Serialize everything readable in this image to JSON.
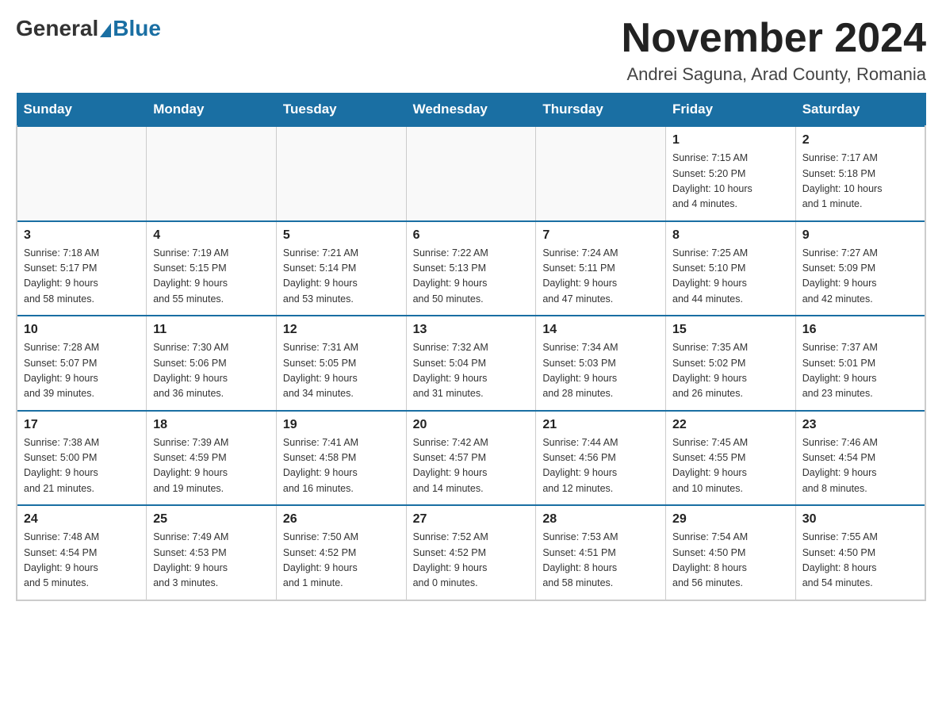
{
  "logo": {
    "general": "General",
    "blue": "Blue"
  },
  "title": "November 2024",
  "location": "Andrei Saguna, Arad County, Romania",
  "days_of_week": [
    "Sunday",
    "Monday",
    "Tuesday",
    "Wednesday",
    "Thursday",
    "Friday",
    "Saturday"
  ],
  "weeks": [
    [
      {
        "day": "",
        "info": ""
      },
      {
        "day": "",
        "info": ""
      },
      {
        "day": "",
        "info": ""
      },
      {
        "day": "",
        "info": ""
      },
      {
        "day": "",
        "info": ""
      },
      {
        "day": "1",
        "info": "Sunrise: 7:15 AM\nSunset: 5:20 PM\nDaylight: 10 hours\nand 4 minutes."
      },
      {
        "day": "2",
        "info": "Sunrise: 7:17 AM\nSunset: 5:18 PM\nDaylight: 10 hours\nand 1 minute."
      }
    ],
    [
      {
        "day": "3",
        "info": "Sunrise: 7:18 AM\nSunset: 5:17 PM\nDaylight: 9 hours\nand 58 minutes."
      },
      {
        "day": "4",
        "info": "Sunrise: 7:19 AM\nSunset: 5:15 PM\nDaylight: 9 hours\nand 55 minutes."
      },
      {
        "day": "5",
        "info": "Sunrise: 7:21 AM\nSunset: 5:14 PM\nDaylight: 9 hours\nand 53 minutes."
      },
      {
        "day": "6",
        "info": "Sunrise: 7:22 AM\nSunset: 5:13 PM\nDaylight: 9 hours\nand 50 minutes."
      },
      {
        "day": "7",
        "info": "Sunrise: 7:24 AM\nSunset: 5:11 PM\nDaylight: 9 hours\nand 47 minutes."
      },
      {
        "day": "8",
        "info": "Sunrise: 7:25 AM\nSunset: 5:10 PM\nDaylight: 9 hours\nand 44 minutes."
      },
      {
        "day": "9",
        "info": "Sunrise: 7:27 AM\nSunset: 5:09 PM\nDaylight: 9 hours\nand 42 minutes."
      }
    ],
    [
      {
        "day": "10",
        "info": "Sunrise: 7:28 AM\nSunset: 5:07 PM\nDaylight: 9 hours\nand 39 minutes."
      },
      {
        "day": "11",
        "info": "Sunrise: 7:30 AM\nSunset: 5:06 PM\nDaylight: 9 hours\nand 36 minutes."
      },
      {
        "day": "12",
        "info": "Sunrise: 7:31 AM\nSunset: 5:05 PM\nDaylight: 9 hours\nand 34 minutes."
      },
      {
        "day": "13",
        "info": "Sunrise: 7:32 AM\nSunset: 5:04 PM\nDaylight: 9 hours\nand 31 minutes."
      },
      {
        "day": "14",
        "info": "Sunrise: 7:34 AM\nSunset: 5:03 PM\nDaylight: 9 hours\nand 28 minutes."
      },
      {
        "day": "15",
        "info": "Sunrise: 7:35 AM\nSunset: 5:02 PM\nDaylight: 9 hours\nand 26 minutes."
      },
      {
        "day": "16",
        "info": "Sunrise: 7:37 AM\nSunset: 5:01 PM\nDaylight: 9 hours\nand 23 minutes."
      }
    ],
    [
      {
        "day": "17",
        "info": "Sunrise: 7:38 AM\nSunset: 5:00 PM\nDaylight: 9 hours\nand 21 minutes."
      },
      {
        "day": "18",
        "info": "Sunrise: 7:39 AM\nSunset: 4:59 PM\nDaylight: 9 hours\nand 19 minutes."
      },
      {
        "day": "19",
        "info": "Sunrise: 7:41 AM\nSunset: 4:58 PM\nDaylight: 9 hours\nand 16 minutes."
      },
      {
        "day": "20",
        "info": "Sunrise: 7:42 AM\nSunset: 4:57 PM\nDaylight: 9 hours\nand 14 minutes."
      },
      {
        "day": "21",
        "info": "Sunrise: 7:44 AM\nSunset: 4:56 PM\nDaylight: 9 hours\nand 12 minutes."
      },
      {
        "day": "22",
        "info": "Sunrise: 7:45 AM\nSunset: 4:55 PM\nDaylight: 9 hours\nand 10 minutes."
      },
      {
        "day": "23",
        "info": "Sunrise: 7:46 AM\nSunset: 4:54 PM\nDaylight: 9 hours\nand 8 minutes."
      }
    ],
    [
      {
        "day": "24",
        "info": "Sunrise: 7:48 AM\nSunset: 4:54 PM\nDaylight: 9 hours\nand 5 minutes."
      },
      {
        "day": "25",
        "info": "Sunrise: 7:49 AM\nSunset: 4:53 PM\nDaylight: 9 hours\nand 3 minutes."
      },
      {
        "day": "26",
        "info": "Sunrise: 7:50 AM\nSunset: 4:52 PM\nDaylight: 9 hours\nand 1 minute."
      },
      {
        "day": "27",
        "info": "Sunrise: 7:52 AM\nSunset: 4:52 PM\nDaylight: 9 hours\nand 0 minutes."
      },
      {
        "day": "28",
        "info": "Sunrise: 7:53 AM\nSunset: 4:51 PM\nDaylight: 8 hours\nand 58 minutes."
      },
      {
        "day": "29",
        "info": "Sunrise: 7:54 AM\nSunset: 4:50 PM\nDaylight: 8 hours\nand 56 minutes."
      },
      {
        "day": "30",
        "info": "Sunrise: 7:55 AM\nSunset: 4:50 PM\nDaylight: 8 hours\nand 54 minutes."
      }
    ]
  ]
}
